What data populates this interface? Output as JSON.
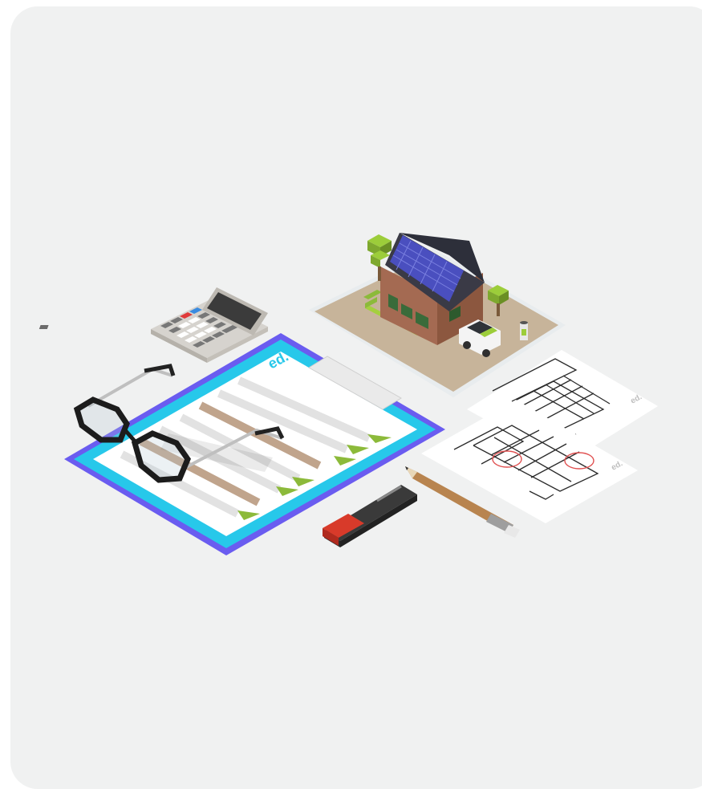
{
  "clipboard": {
    "brand": "ed."
  },
  "blueprint_top": {
    "brand": "ed."
  },
  "blueprint_bottom": {
    "brand": "ed."
  },
  "colors": {
    "background": "#f0f1f1",
    "clipboard_border": "#6a5cf0",
    "clipboard_inner": "#27c8ea",
    "check": "#8cba3a",
    "brand": "#27c8ea",
    "solar_panel": "#4a4fbf",
    "marker_body": "#3a3a3a",
    "marker_cap": "#d83a2a",
    "pencil": "#b8844f",
    "calc_red": "#e03a3a",
    "calc_blue": "#3a8be0"
  }
}
